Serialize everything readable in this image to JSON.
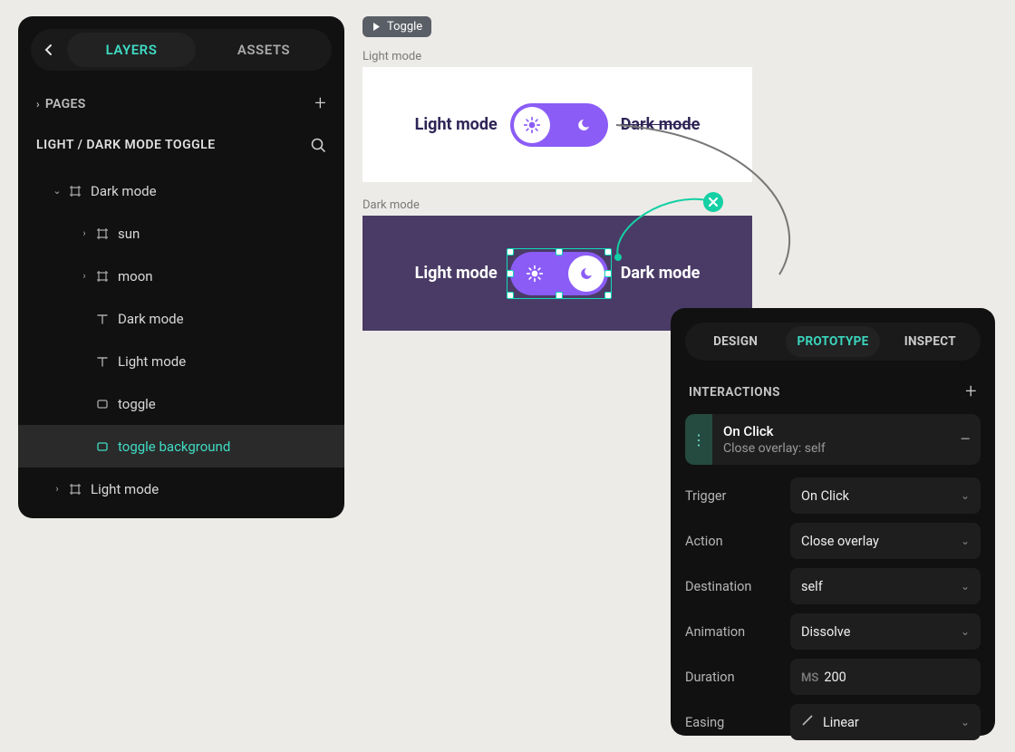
{
  "layers_panel": {
    "tabs": {
      "layers": "LAYERS",
      "assets": "ASSETS"
    },
    "pages_label": "PAGES",
    "file_title": "LIGHT / DARK MODE TOGGLE",
    "tree": {
      "dark_mode": "Dark mode",
      "sun": "sun",
      "moon": "moon",
      "t_dark": "Dark mode",
      "t_light": "Light mode",
      "toggle": "toggle",
      "toggle_bg": "toggle background",
      "light_mode": "Light mode"
    }
  },
  "canvas": {
    "tag_label": "Toggle",
    "frame_light_caption": "Light mode",
    "frame_dark_caption": "Dark mode",
    "txt_light": "Light mode",
    "txt_dark": "Dark mode"
  },
  "proto_panel": {
    "tabs": {
      "design": "DESIGN",
      "prototype": "PROTOTYPE",
      "inspect": "INSPECT"
    },
    "interactions_label": "INTERACTIONS",
    "interaction": {
      "title": "On Click",
      "subtitle": "Close overlay: self"
    },
    "labels": {
      "trigger": "Trigger",
      "action": "Action",
      "destination": "Destination",
      "animation": "Animation",
      "duration": "Duration",
      "easing": "Easing"
    },
    "values": {
      "trigger": "On Click",
      "action": "Close overlay",
      "destination": "self",
      "animation": "Dissolve",
      "duration_prefix": "MS",
      "duration": "200",
      "easing": "Linear"
    }
  }
}
